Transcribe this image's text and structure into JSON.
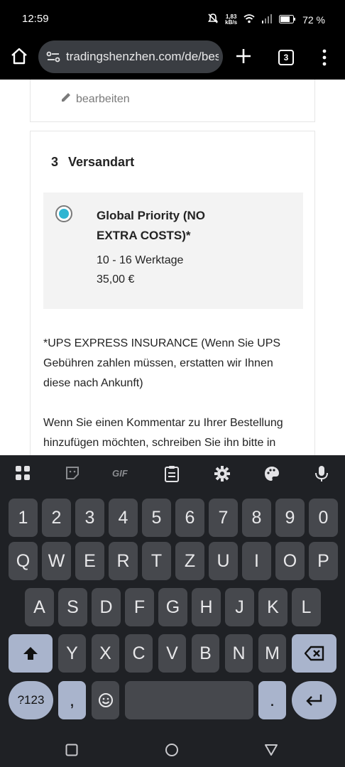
{
  "status_bar": {
    "time": "12:59",
    "net_speed_top": "1,83",
    "net_speed_bottom": "kB/s",
    "battery": "72 %"
  },
  "browser": {
    "url": "tradingshenzhen.com/de/bes",
    "tab_count": "3"
  },
  "page": {
    "edit_label": "bearbeiten",
    "section_number": "3",
    "section_title": "Versandart",
    "shipping_option": {
      "name": "Global Priority (NO EXTRA COSTS)*",
      "delay": "10 - 16 Werktage",
      "price": "35,00 €",
      "selected": true,
      "radio_color": "#2fb5d2"
    },
    "insurance_note": "*UPS EXPRESS INSURANCE (Wenn Sie UPS Gebühren zahlen müssen, erstatten wir Ihnen diese nach Ankunft)",
    "comment_note": "Wenn Sie einen Kommentar zu Ihrer Bestellung hinzufügen möchten, schreiben Sie ihn bitte in"
  },
  "keyboard": {
    "toolbar_icons": [
      "apps-grid-icon",
      "sticker-icon",
      "gif-icon",
      "clipboard-icon",
      "settings-gear-icon",
      "palette-icon",
      "microphone-icon"
    ],
    "gif_label": "GIF",
    "row_numbers": [
      "1",
      "2",
      "3",
      "4",
      "5",
      "6",
      "7",
      "8",
      "9",
      "0"
    ],
    "row_1": [
      "Q",
      "W",
      "E",
      "R",
      "T",
      "Z",
      "U",
      "I",
      "O",
      "P"
    ],
    "row_2": [
      "A",
      "S",
      "D",
      "F",
      "G",
      "H",
      "J",
      "K",
      "L"
    ],
    "row_3": [
      "Y",
      "X",
      "C",
      "V",
      "B",
      "N",
      "M"
    ],
    "symbols_label": "?123",
    "comma_label": ",",
    "period_label": "."
  }
}
